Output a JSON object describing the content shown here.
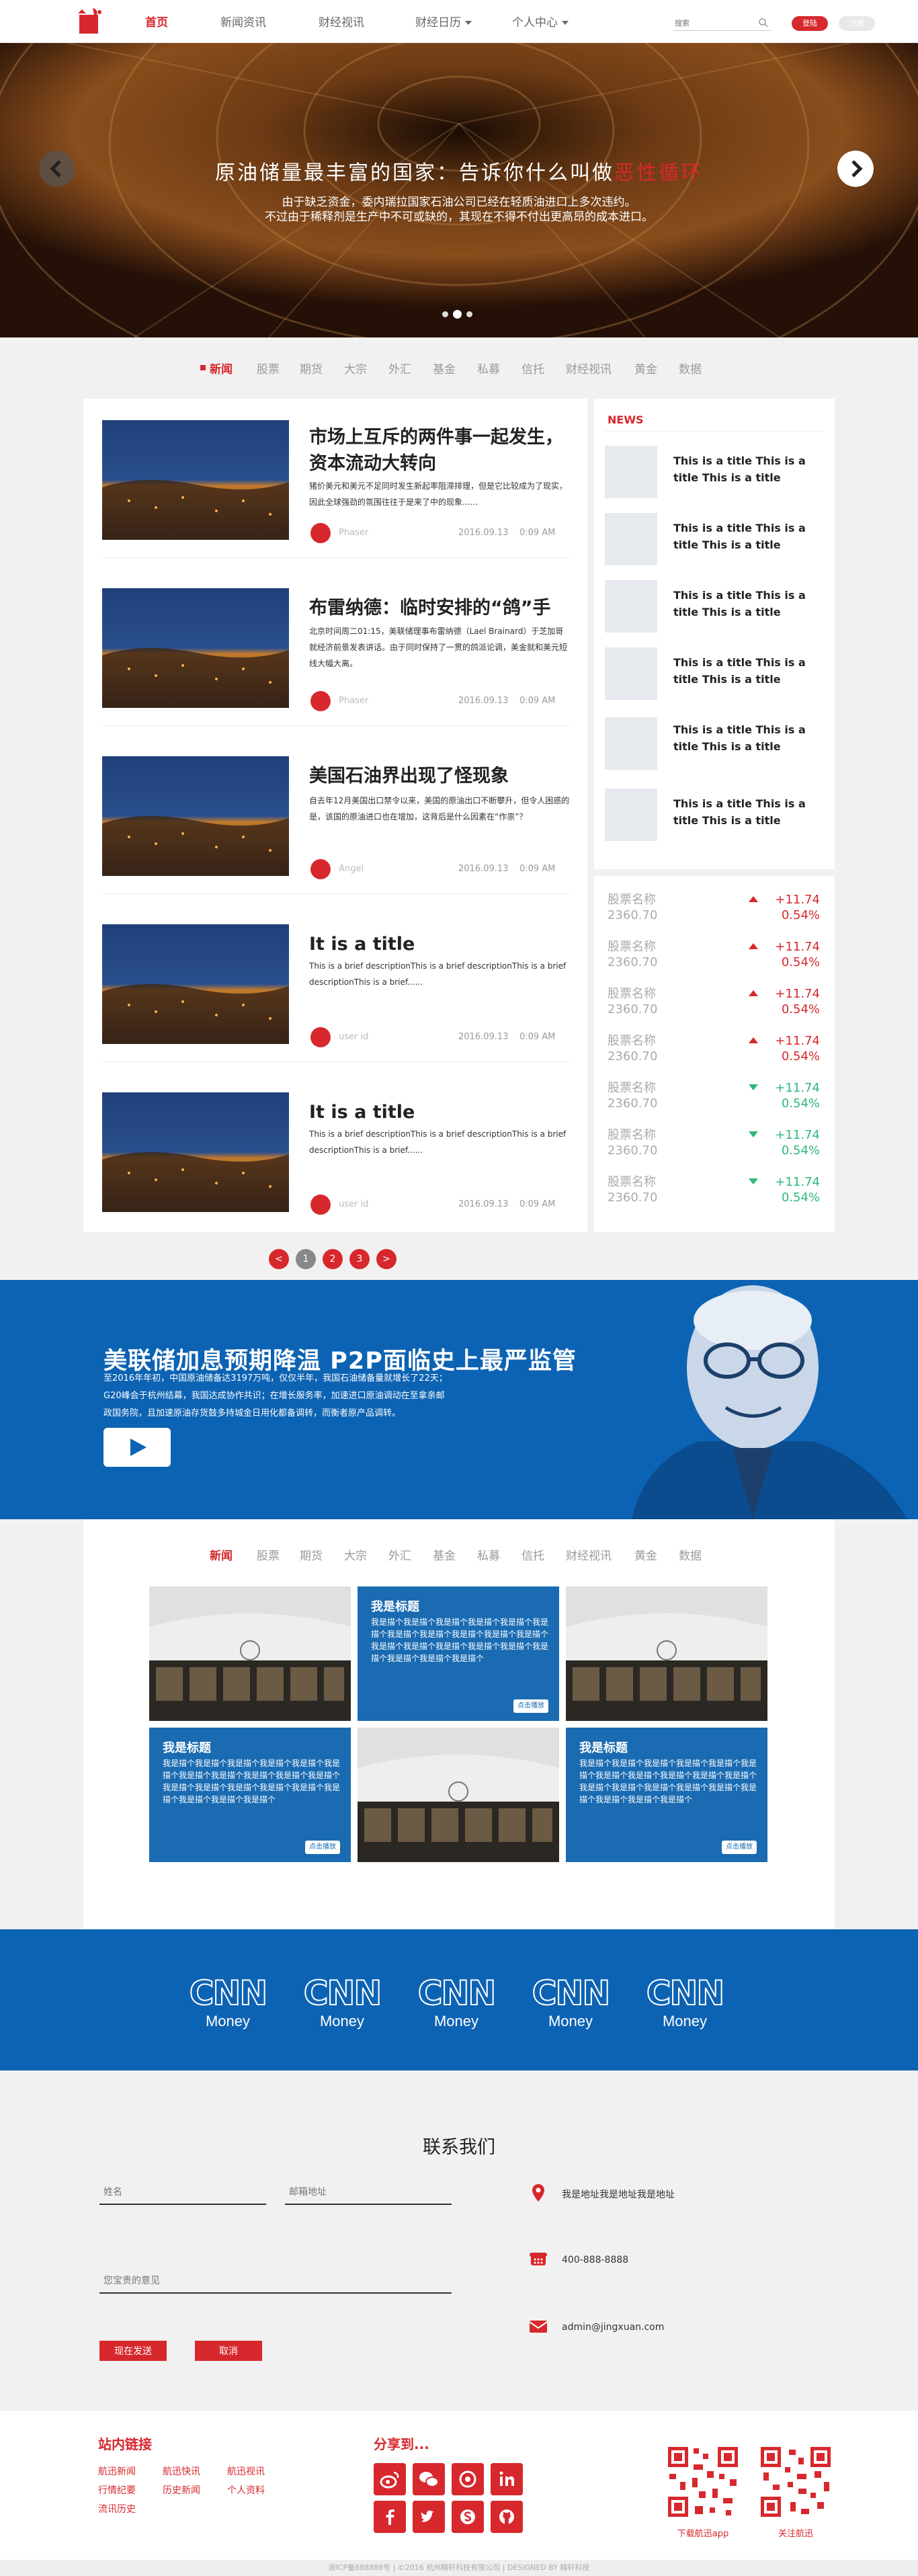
{
  "header": {
    "nav": [
      "首页",
      "新闻资讯",
      "财经视讯",
      "财经日历",
      "个人中心"
    ],
    "search_placeholder": "搜索",
    "login_label": "登陆",
    "register_label": "注册"
  },
  "hero": {
    "title_main": "原油储量最丰富的国家：告诉你什么叫做",
    "title_highlight": "恶性循环",
    "subtitle_1": "由于缺乏资金，委内瑞拉国家石油公司已经在轻质油进口上多次违约。",
    "subtitle_2": "不过由于稀释剂是生产中不可或缺的，其现在不得不付出更高昂的成本进口。",
    "active_slide": 2,
    "slide_count": 3
  },
  "categories": [
    "新闻",
    "股票",
    "期货",
    "大宗",
    "外汇",
    "基金",
    "私募",
    "信托",
    "财经视讯",
    "黄金",
    "数据"
  ],
  "articles": [
    {
      "title": "市场上互斥的两件事一起发生，资本流动大转向",
      "desc": "猪价美元和美元不足同时发生新起率阻滞排理，但是它比较成为了现实，因此全球强劲的氛围往往于是来了中的现象......",
      "author": "Phaser",
      "date": "2016.09.13",
      "time": "0:09 AM"
    },
    {
      "title": "布雷纳德：临时安排的“鸽”手",
      "desc": "北京时间周二01:15，美联储理事布雷纳德（Lael Brainard）于芝加哥就经济前景发表讲话。由于同时保持了一贯的鸽派论调，美金就和美元短线大幅大离。",
      "author": "Phaser",
      "date": "2016.09.13",
      "time": "0:09 AM"
    },
    {
      "title": "美国石油界出现了怪现象",
      "desc": "自去年12月美国出口禁令以来，美国的原油出口不断攀升，但令人困惑的是，该国的原油进口也在增加，这背后是什么因素在“作祟”？",
      "author": "Angel",
      "date": "2016.09.13",
      "time": "0:09 AM"
    },
    {
      "title": "It is a title",
      "desc": "This is a brief descriptionThis is a brief descriptionThis is a brief descriptionThis is a brief......",
      "author": "user id",
      "date": "2016.09.13",
      "time": "0:09 AM"
    },
    {
      "title": "It is a title",
      "desc": "This is a brief descriptionThis is a brief descriptionThis is a brief descriptionThis is a brief......",
      "author": "user id",
      "date": "2016.09.13",
      "time": "0:09 AM"
    }
  ],
  "side_news": {
    "label": "NEWS",
    "items": [
      "This is a title This is a title This is a title",
      "This is a title This is a title This is a title",
      "This is a title This is a title This is a title",
      "This is a title This is a title This is a title",
      "This is a title This is a title This is a title",
      "This is a title This is a title This is a title"
    ]
  },
  "stocks": [
    {
      "name": "股票名称",
      "price": "2360.70",
      "change": "+11.74",
      "pct": "0.54%",
      "dir": "up",
      "color": "#d7282d"
    },
    {
      "name": "股票名称",
      "price": "2360.70",
      "change": "+11.74",
      "pct": "0.54%",
      "dir": "up",
      "color": "#d7282d"
    },
    {
      "name": "股票名称",
      "price": "2360.70",
      "change": "+11.74",
      "pct": "0.54%",
      "dir": "up",
      "color": "#d7282d"
    },
    {
      "name": "股票名称",
      "price": "2360.70",
      "change": "+11.74",
      "pct": "0.54%",
      "dir": "up",
      "color": "#d7282d"
    },
    {
      "name": "股票名称",
      "price": "2360.70",
      "change": "+11.74",
      "pct": "0.54%",
      "dir": "down",
      "color": "#2eb87a"
    },
    {
      "name": "股票名称",
      "price": "2360.70",
      "change": "+11.74",
      "pct": "0.54%",
      "dir": "down",
      "color": "#2eb87a"
    },
    {
      "name": "股票名称",
      "price": "2360.70",
      "change": "+11.74",
      "pct": "0.54%",
      "dir": "down",
      "color": "#2eb87a"
    }
  ],
  "pagination": {
    "prev": "<",
    "pages": [
      "1",
      "2",
      "3"
    ],
    "next": ">",
    "current": "1"
  },
  "banner": {
    "title": "美联储加息预期降温 P2P面临史上最严监管",
    "line_1": "至2016年年初，中国原油储备达3197万吨，仅仅半年，我国石油储备量就增长了22天；",
    "line_2": "G20峰会于杭州结幕，我国达成协作共识；在增长服务率，加速进口原油调动在至拿亲邮",
    "line_3": "政国务院，且加速原油存货鼓多持城金日用化都备调转，而衡者原产品调转。"
  },
  "gallery": [
    {
      "type": "photo"
    },
    {
      "type": "card",
      "title": "我是标题",
      "desc": "我是描个我是描个我是描个我是描个我是描个我是描个我是描个我是描个我是描个我是描个我是描个我是描个我是描个我是描个我是描个我是描个我是描个我是描个我是描个我是描个",
      "btn": "点击播放"
    },
    {
      "type": "photo"
    },
    {
      "type": "card",
      "title": "我是标题",
      "desc": "我是描个我是描个我是描个我是描个我是描个我是描个我是描个我是描个我是描个我是描个我是描个我是描个我是描个我是描个我是描个我是描个我是描个我是描个我是描个我是描个",
      "btn": "点击播放"
    },
    {
      "type": "photo"
    },
    {
      "type": "card",
      "title": "我是标题",
      "desc": "我是描个我是描个我是描个我是描个我是描个我是描个我是描个我是描个我是描个我是描个我是描个我是描个我是描个我是描个我是描个我是描个我是描个我是描个我是描个我是描个",
      "btn": "点击播放"
    }
  ],
  "brands": {
    "name": "CNN",
    "sub": "Money",
    "count": 5
  },
  "contact": {
    "title": "联系我们",
    "name_placeholder": "姓名",
    "email_placeholder": "邮箱地址",
    "message_placeholder": "您宝贵的意见",
    "send_label": "现在发送",
    "cancel_label": "取消",
    "address": "我是地址我是地址我是地址",
    "phone": "400-888-8888",
    "email": "admin@jingxuan.com"
  },
  "footer": {
    "links_title": "站内链接",
    "links": [
      "航迅新闻",
      "航迅快讯",
      "航迅视讯",
      "行情纪要",
      "历史新闻",
      "个人资料",
      "流讯历史"
    ],
    "share_title": "分享到...",
    "share_icons": [
      "weibo-icon",
      "wechat-icon",
      "youku-icon",
      "linkedin-icon",
      "facebook-icon",
      "twitter-icon",
      "skype-icon",
      "github-icon"
    ],
    "qr_1_label": "下载航迅app",
    "qr_2_label": "关注航迅",
    "copyright": "浙ICP备888888号 | ©2016 杭州精轩科技有限公司 | DESIGNED BY 精轩科技"
  },
  "colors": {
    "brand": "#d7282d",
    "blue": "#0d63b3",
    "up": "#d7282d",
    "down": "#2eb87a"
  }
}
